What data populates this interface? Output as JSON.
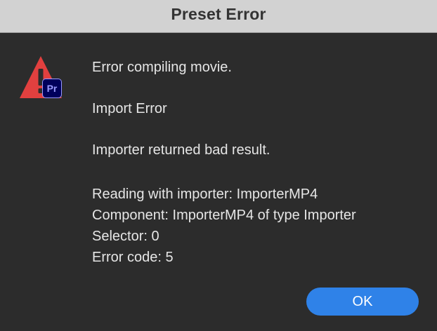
{
  "dialog": {
    "title": "Preset Error",
    "badge_text": "Pr",
    "messages": {
      "line1": "Error compiling movie.",
      "line2": "Import Error",
      "line3": "Importer returned bad result.",
      "details": [
        "Reading with importer: ImporterMP4",
        "Component: ImporterMP4 of type Importer",
        "Selector: 0",
        "Error code: 5"
      ]
    },
    "ok_label": "OK"
  },
  "icons": {
    "alert": "warning-triangle-icon",
    "app": "premiere-pro-icon"
  },
  "colors": {
    "background": "#2c2c2c",
    "titlebar": "#d2d2d2",
    "warning_red": "#e2403f",
    "button_blue": "#2f82e8",
    "badge_bg": "#00005b",
    "badge_fg": "#9999ff"
  }
}
